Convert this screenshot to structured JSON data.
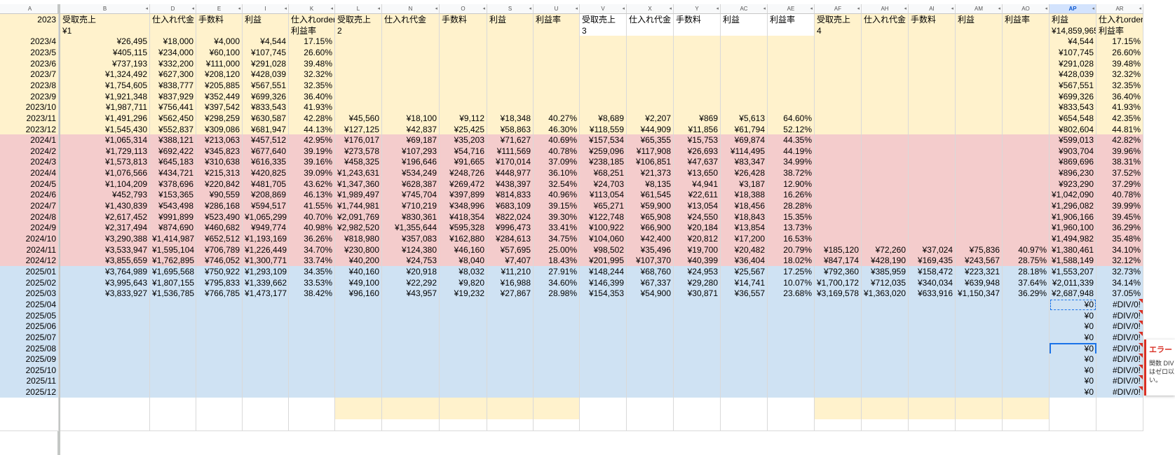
{
  "columns": [
    {
      "letter": "A",
      "w": 84
    },
    {
      "letter": "B",
      "w": 128
    },
    {
      "letter": "D",
      "w": 66
    },
    {
      "letter": "E",
      "w": 66
    },
    {
      "letter": "I",
      "w": 66
    },
    {
      "letter": "K",
      "w": 66
    },
    {
      "letter": "L",
      "w": 67
    },
    {
      "letter": "N",
      "w": 82
    },
    {
      "letter": "O",
      "w": 68
    },
    {
      "letter": "S",
      "w": 66
    },
    {
      "letter": "U",
      "w": 66
    },
    {
      "letter": "V",
      "w": 67
    },
    {
      "letter": "X",
      "w": 67
    },
    {
      "letter": "Y",
      "w": 67
    },
    {
      "letter": "AC",
      "w": 67
    },
    {
      "letter": "AE",
      "w": 67
    },
    {
      "letter": "AF",
      "w": 67
    },
    {
      "letter": "AH",
      "w": 67
    },
    {
      "letter": "AI",
      "w": 67
    },
    {
      "letter": "AM",
      "w": 67
    },
    {
      "letter": "AO",
      "w": 67
    },
    {
      "letter": "AP",
      "w": 67
    },
    {
      "letter": "AR",
      "w": 67
    }
  ],
  "selected_column": "AP",
  "header_row1": [
    "2023",
    "受取売上",
    "仕入れ代金",
    "手数料",
    "利益",
    "仕入れorderI",
    "受取売上",
    "仕入れ代金",
    "手数料",
    "利益",
    "利益率",
    "受取売上",
    "仕入れ代金",
    "手数料",
    "利益",
    "利益率",
    "受取売上",
    "仕入れ代金",
    "手数料",
    "利益",
    "利益率",
    "利益",
    "仕入れorderI"
  ],
  "header_row2": [
    "",
    "¥1",
    "",
    "",
    "",
    "利益率",
    "2",
    "",
    "",
    "",
    "",
    "3",
    "",
    "",
    "",
    "",
    "4",
    "",
    "",
    "",
    "",
    "¥14,859,965",
    "利益率"
  ],
  "rows": [
    {
      "c": "y",
      "v": [
        "2023/4",
        "¥26,495",
        "¥18,000",
        "¥4,000",
        "¥4,544",
        "17.15%",
        "",
        "",
        "",
        "",
        "",
        "",
        "",
        "",
        "",
        "",
        "",
        "",
        "",
        "",
        "",
        "¥4,544",
        "17.15%"
      ]
    },
    {
      "c": "y",
      "v": [
        "2023/5",
        "¥405,115",
        "¥234,000",
        "¥60,100",
        "¥107,745",
        "26.60%",
        "",
        "",
        "",
        "",
        "",
        "",
        "",
        "",
        "",
        "",
        "",
        "",
        "",
        "",
        "",
        "¥107,745",
        "26.60%"
      ]
    },
    {
      "c": "y",
      "v": [
        "2023/6",
        "¥737,193",
        "¥332,200",
        "¥111,000",
        "¥291,028",
        "39.48%",
        "",
        "",
        "",
        "",
        "",
        "",
        "",
        "",
        "",
        "",
        "",
        "",
        "",
        "",
        "",
        "¥291,028",
        "39.48%"
      ]
    },
    {
      "c": "y",
      "v": [
        "2023/7",
        "¥1,324,492",
        "¥627,300",
        "¥208,120",
        "¥428,039",
        "32.32%",
        "",
        "",
        "",
        "",
        "",
        "",
        "",
        "",
        "",
        "",
        "",
        "",
        "",
        "",
        "",
        "¥428,039",
        "32.32%"
      ]
    },
    {
      "c": "y",
      "v": [
        "2023/8",
        "¥1,754,605",
        "¥838,777",
        "¥205,885",
        "¥567,551",
        "32.35%",
        "",
        "",
        "",
        "",
        "",
        "",
        "",
        "",
        "",
        "",
        "",
        "",
        "",
        "",
        "",
        "¥567,551",
        "32.35%"
      ]
    },
    {
      "c": "y",
      "v": [
        "2023/9",
        "¥1,921,348",
        "¥837,929",
        "¥352,449",
        "¥699,326",
        "36.40%",
        "",
        "",
        "",
        "",
        "",
        "",
        "",
        "",
        "",
        "",
        "",
        "",
        "",
        "",
        "",
        "¥699,326",
        "36.40%"
      ]
    },
    {
      "c": "y",
      "v": [
        "2023/10",
        "¥1,987,711",
        "¥756,441",
        "¥397,542",
        "¥833,543",
        "41.93%",
        "",
        "",
        "",
        "",
        "",
        "",
        "",
        "",
        "",
        "",
        "",
        "",
        "",
        "",
        "",
        "¥833,543",
        "41.93%"
      ]
    },
    {
      "c": "y",
      "v": [
        "2023/11",
        "¥1,491,296",
        "¥562,450",
        "¥298,259",
        "¥630,587",
        "42.28%",
        "¥45,560",
        "¥18,100",
        "¥9,112",
        "¥18,348",
        "40.27%",
        "¥8,689",
        "¥2,207",
        "¥869",
        "¥5,613",
        "64.60%",
        "",
        "",
        "",
        "",
        "",
        "¥654,548",
        "42.35%"
      ]
    },
    {
      "c": "y",
      "v": [
        "2023/12",
        "¥1,545,430",
        "¥552,837",
        "¥309,086",
        "¥681,947",
        "44.13%",
        "¥127,125",
        "¥42,837",
        "¥25,425",
        "¥58,863",
        "46.30%",
        "¥118,559",
        "¥44,909",
        "¥11,856",
        "¥61,794",
        "52.12%",
        "",
        "",
        "",
        "",
        "",
        "¥802,604",
        "44.81%"
      ]
    },
    {
      "c": "p",
      "v": [
        "2024/1",
        "¥1,065,314",
        "¥388,121",
        "¥213,063",
        "¥457,512",
        "42.95%",
        "¥176,017",
        "¥69,187",
        "¥35,203",
        "¥71,627",
        "40.69%",
        "¥157,534",
        "¥65,355",
        "¥15,753",
        "¥69,874",
        "44.35%",
        "",
        "",
        "",
        "",
        "",
        "¥599,013",
        "42.82%"
      ]
    },
    {
      "c": "p",
      "v": [
        "2024/2",
        "¥1,729,113",
        "¥692,422",
        "¥345,823",
        "¥677,640",
        "39.19%",
        "¥273,578",
        "¥107,293",
        "¥54,716",
        "¥111,569",
        "40.78%",
        "¥259,096",
        "¥117,908",
        "¥26,693",
        "¥114,495",
        "44.19%",
        "",
        "",
        "",
        "",
        "",
        "¥903,704",
        "39.96%"
      ]
    },
    {
      "c": "p",
      "v": [
        "2024/3",
        "¥1,573,813",
        "¥645,183",
        "¥310,638",
        "¥616,335",
        "39.16%",
        "¥458,325",
        "¥196,646",
        "¥91,665",
        "¥170,014",
        "37.09%",
        "¥238,185",
        "¥106,851",
        "¥47,637",
        "¥83,347",
        "34.99%",
        "",
        "",
        "",
        "",
        "",
        "¥869,696",
        "38.31%"
      ]
    },
    {
      "c": "p",
      "v": [
        "2024/4",
        "¥1,076,566",
        "¥434,721",
        "¥215,313",
        "¥420,825",
        "39.09%",
        "¥1,243,631",
        "¥534,249",
        "¥248,726",
        "¥448,977",
        "36.10%",
        "¥68,251",
        "¥21,373",
        "¥13,650",
        "¥26,428",
        "38.72%",
        "",
        "",
        "",
        "",
        "",
        "¥896,230",
        "37.52%"
      ]
    },
    {
      "c": "p",
      "v": [
        "2024/5",
        "¥1,104,209",
        "¥378,696",
        "¥220,842",
        "¥481,705",
        "43.62%",
        "¥1,347,360",
        "¥628,387",
        "¥269,472",
        "¥438,397",
        "32.54%",
        "¥24,703",
        "¥8,135",
        "¥4,941",
        "¥3,187",
        "12.90%",
        "",
        "",
        "",
        "",
        "",
        "¥923,290",
        "37.29%"
      ]
    },
    {
      "c": "p",
      "v": [
        "2024/6",
        "¥452,793",
        "¥153,365",
        "¥90,559",
        "¥208,869",
        "46.13%",
        "¥1,989,497",
        "¥745,704",
        "¥397,899",
        "¥814,833",
        "40.96%",
        "¥113,054",
        "¥61,545",
        "¥22,611",
        "¥18,388",
        "16.26%",
        "",
        "",
        "",
        "",
        "",
        "¥1,042,090",
        "40.78%"
      ]
    },
    {
      "c": "p",
      "v": [
        "2024/7",
        "¥1,430,839",
        "¥543,498",
        "¥286,168",
        "¥594,517",
        "41.55%",
        "¥1,744,981",
        "¥710,219",
        "¥348,996",
        "¥683,109",
        "39.15%",
        "¥65,271",
        "¥59,900",
        "¥13,054",
        "¥18,456",
        "28.28%",
        "",
        "",
        "",
        "",
        "",
        "¥1,296,082",
        "39.99%"
      ]
    },
    {
      "c": "p",
      "v": [
        "2024/8",
        "¥2,617,452",
        "¥991,899",
        "¥523,490",
        "¥1,065,299",
        "40.70%",
        "¥2,091,769",
        "¥830,361",
        "¥418,354",
        "¥822,024",
        "39.30%",
        "¥122,748",
        "¥65,908",
        "¥24,550",
        "¥18,843",
        "15.35%",
        "",
        "",
        "",
        "",
        "",
        "¥1,906,166",
        "39.45%"
      ]
    },
    {
      "c": "p",
      "v": [
        "2024/9",
        "¥2,317,494",
        "¥874,690",
        "¥460,682",
        "¥949,774",
        "40.98%",
        "¥2,982,520",
        "¥1,355,644",
        "¥595,328",
        "¥996,473",
        "33.41%",
        "¥100,922",
        "¥66,900",
        "¥20,184",
        "¥13,854",
        "13.73%",
        "",
        "",
        "",
        "",
        "",
        "¥1,960,100",
        "36.29%"
      ]
    },
    {
      "c": "p",
      "v": [
        "2024/10",
        "¥3,290,388",
        "¥1,414,987",
        "¥652,512",
        "¥1,193,169",
        "36.26%",
        "¥818,980",
        "¥357,083",
        "¥162,880",
        "¥284,613",
        "34.75%",
        "¥104,060",
        "¥42,400",
        "¥20,812",
        "¥17,200",
        "16.53%",
        "",
        "",
        "",
        "",
        "",
        "¥1,494,982",
        "35.48%"
      ]
    },
    {
      "c": "p",
      "v": [
        "2024/11",
        "¥3,533,947",
        "¥1,595,104",
        "¥706,789",
        "¥1,226,449",
        "34.70%",
        "¥230,800",
        "¥124,380",
        "¥46,160",
        "¥57,695",
        "25.00%",
        "¥98,502",
        "¥35,496",
        "¥19,700",
        "¥20,482",
        "20.79%",
        "¥185,120",
        "¥72,260",
        "¥37,024",
        "¥75,836",
        "40.97%",
        "¥1,380,461",
        "34.10%"
      ]
    },
    {
      "c": "p",
      "v": [
        "2024/12",
        "¥3,855,659",
        "¥1,762,895",
        "¥746,052",
        "¥1,300,771",
        "33.74%",
        "¥40,200",
        "¥24,753",
        "¥8,040",
        "¥7,407",
        "18.43%",
        "¥201,995",
        "¥107,370",
        "¥40,399",
        "¥36,404",
        "18.02%",
        "¥847,174",
        "¥428,190",
        "¥169,435",
        "¥243,567",
        "28.75%",
        "¥1,588,149",
        "32.12%"
      ]
    },
    {
      "c": "b",
      "v": [
        "2025/01",
        "¥3,764,989",
        "¥1,695,568",
        "¥750,922",
        "¥1,293,109",
        "34.35%",
        "¥40,160",
        "¥20,918",
        "¥8,032",
        "¥11,210",
        "27.91%",
        "¥148,244",
        "¥68,760",
        "¥24,953",
        "¥25,567",
        "17.25%",
        "¥792,360",
        "¥385,959",
        "¥158,472",
        "¥223,321",
        "28.18%",
        "¥1,553,207",
        "32.73%"
      ]
    },
    {
      "c": "b",
      "v": [
        "2025/02",
        "¥3,995,643",
        "¥1,807,155",
        "¥795,833",
        "¥1,339,662",
        "33.53%",
        "¥49,100",
        "¥22,292",
        "¥9,820",
        "¥16,988",
        "34.60%",
        "¥146,399",
        "¥67,337",
        "¥29,280",
        "¥14,741",
        "10.07%",
        "¥1,700,172",
        "¥712,035",
        "¥340,034",
        "¥639,948",
        "37.64%",
        "¥2,011,339",
        "34.14%"
      ]
    },
    {
      "c": "b",
      "v": [
        "2025/03",
        "¥3,833,927",
        "¥1,536,785",
        "¥766,785",
        "¥1,473,177",
        "38.42%",
        "¥96,160",
        "¥43,957",
        "¥19,232",
        "¥27,867",
        "28.98%",
        "¥154,353",
        "¥54,900",
        "¥30,871",
        "¥36,557",
        "23.68%",
        "¥3,169,578",
        "¥1,363,020",
        "¥633,916",
        "¥1,150,347",
        "36.29%",
        "¥2,687,948",
        "37.05%"
      ]
    },
    {
      "c": "b",
      "v": [
        "2025/04",
        "",
        "",
        "",
        "",
        "",
        "",
        "",
        "",
        "",
        "",
        "",
        "",
        "",
        "",
        "",
        "",
        "",
        "",
        "",
        "",
        "¥0",
        "#DIV/0!"
      ]
    },
    {
      "c": "b",
      "v": [
        "2025/05",
        "",
        "",
        "",
        "",
        "",
        "",
        "",
        "",
        "",
        "",
        "",
        "",
        "",
        "",
        "",
        "",
        "",
        "",
        "",
        "",
        "¥0",
        "#DIV/0!"
      ]
    },
    {
      "c": "b",
      "v": [
        "2025/06",
        "",
        "",
        "",
        "",
        "",
        "",
        "",
        "",
        "",
        "",
        "",
        "",
        "",
        "",
        "",
        "",
        "",
        "",
        "",
        "",
        "¥0",
        "#DIV/0!"
      ]
    },
    {
      "c": "b",
      "v": [
        "2025/07",
        "",
        "",
        "",
        "",
        "",
        "",
        "",
        "",
        "",
        "",
        "",
        "",
        "",
        "",
        "",
        "",
        "",
        "",
        "",
        "",
        "¥0",
        "#DIV/0!"
      ]
    },
    {
      "c": "b",
      "v": [
        "2025/08",
        "",
        "",
        "",
        "",
        "",
        "",
        "",
        "",
        "",
        "",
        "",
        "",
        "",
        "",
        "",
        "",
        "",
        "",
        "",
        "",
        "¥0",
        "#DIV/0!"
      ]
    },
    {
      "c": "b",
      "v": [
        "2025/09",
        "",
        "",
        "",
        "",
        "",
        "",
        "",
        "",
        "",
        "",
        "",
        "",
        "",
        "",
        "",
        "",
        "",
        "",
        "",
        "",
        "¥0",
        "#DIV/0!"
      ]
    },
    {
      "c": "b",
      "v": [
        "2025/10",
        "",
        "",
        "",
        "",
        "",
        "",
        "",
        "",
        "",
        "",
        "",
        "",
        "",
        "",
        "",
        "",
        "",
        "",
        "",
        "",
        "¥0",
        "#DIV/0!"
      ]
    },
    {
      "c": "b",
      "v": [
        "2025/11",
        "",
        "",
        "",
        "",
        "",
        "",
        "",
        "",
        "",
        "",
        "",
        "",
        "",
        "",
        "",
        "",
        "",
        "",
        "",
        "",
        "¥0",
        "#DIV/0!"
      ]
    },
    {
      "c": "b",
      "v": [
        "2025/12",
        "",
        "",
        "",
        "",
        "",
        "",
        "",
        "",
        "",
        "",
        "",
        "",
        "",
        "",
        "",
        "",
        "",
        "",
        "",
        "",
        "¥0",
        "#DIV/0!"
      ]
    }
  ],
  "error_popup": {
    "title": "エラー",
    "message": "関数 DIV\nはゼロ以\nい。"
  },
  "colors": {
    "yellow": "#fff2cc",
    "pink": "#f4cccc",
    "blue": "#cfe2f3",
    "selection": "#1a73e8",
    "error": "#d93025"
  }
}
